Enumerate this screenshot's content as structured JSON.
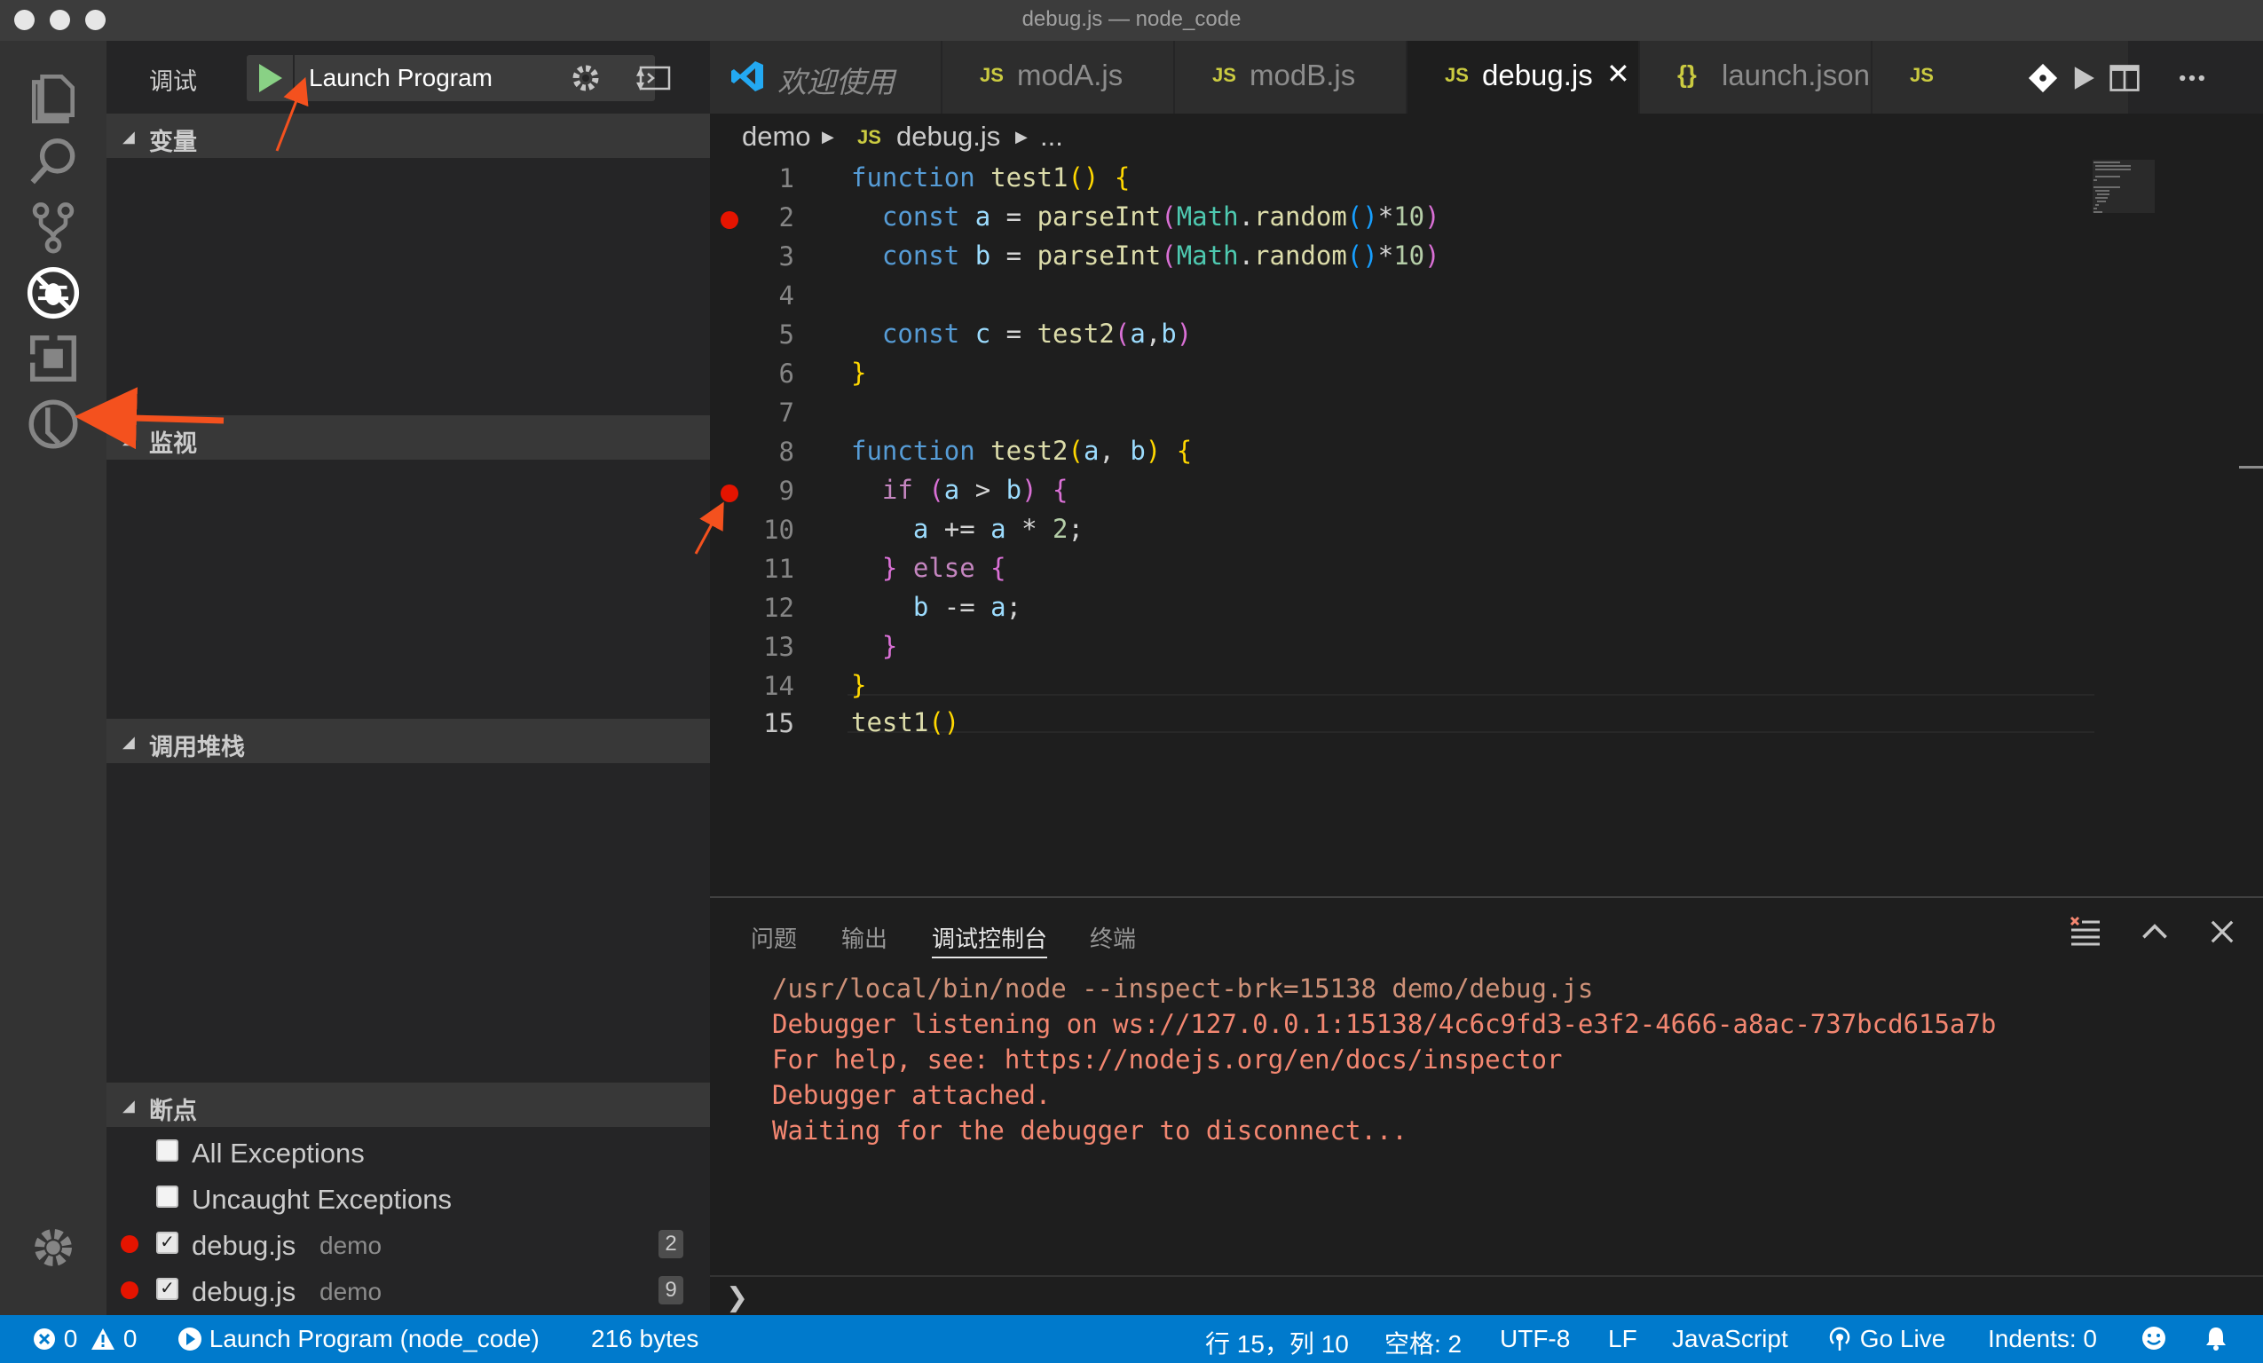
{
  "window": {
    "title": "debug.js — node_code"
  },
  "activity_bar": {
    "items": [
      "explorer-icon",
      "search-icon",
      "source-control-icon",
      "debug-icon",
      "extensions-icon",
      "timeline-icon"
    ],
    "bottom": "gear-icon"
  },
  "sidebar": {
    "debug_label": "调试",
    "launch_config": "Launch Program",
    "sections": {
      "variables": "变量",
      "watch": "监视",
      "call_stack": "调用堆栈",
      "breakpoints": "断点"
    },
    "breakpoints": [
      {
        "label": "All Exceptions",
        "checked": false
      },
      {
        "label": "Uncaught Exceptions",
        "checked": false
      },
      {
        "file": "debug.js",
        "dir": "demo",
        "line": "2",
        "checked": true
      },
      {
        "file": "debug.js",
        "dir": "demo",
        "line": "9",
        "checked": true
      }
    ]
  },
  "tabs": [
    {
      "label": "欢迎使用",
      "icon": "vscode-logo-icon",
      "active": false
    },
    {
      "label": "modA.js",
      "icon": "JS",
      "active": false
    },
    {
      "label": "modB.js",
      "icon": "JS",
      "active": false
    },
    {
      "label": "debug.js",
      "icon": "JS",
      "active": true,
      "close": "✕"
    },
    {
      "label": "launch.json",
      "icon": "{}",
      "active": false
    },
    {
      "label": "",
      "icon": "JS",
      "active": false
    }
  ],
  "breadcrumb": {
    "folder": "demo",
    "file_icon": "JS",
    "file": "debug.js",
    "more": "..."
  },
  "editor": {
    "line_numbers": [
      "1",
      "2",
      "3",
      "4",
      "5",
      "6",
      "7",
      "8",
      "9",
      "10",
      "11",
      "12",
      "13",
      "14",
      "15"
    ],
    "breakpoint_lines": [
      2,
      9
    ],
    "current_line": 15
  },
  "panel": {
    "tabs": [
      "问题",
      "输出",
      "调试控制台",
      "终端"
    ],
    "active_tab": "调试控制台",
    "console": [
      "/usr/local/bin/node --inspect-brk=15138 demo/debug.js",
      "Debugger listening on ws://127.0.0.1:15138/4c6c9fd3-e3f2-4666-a8ac-737bcd615a7b",
      "For help, see: https://nodejs.org/en/docs/inspector",
      "Debugger attached.",
      "Waiting for the debugger to disconnect..."
    ],
    "prompt": "❯"
  },
  "statusbar": {
    "errors": "0",
    "warnings": "0",
    "launch": "Launch Program (node_code)",
    "size": "216 bytes",
    "position": "行 15，列 10",
    "indent": "空格: 2",
    "encoding": "UTF-8",
    "eol": "LF",
    "language": "JavaScript",
    "golive": "Go Live",
    "indents": "Indents: 0",
    "color_bg": "#007acc"
  },
  "colors": {
    "breakpoint": "#e51400",
    "annotation_arrow": "#f4511e",
    "play": "#89d185"
  }
}
